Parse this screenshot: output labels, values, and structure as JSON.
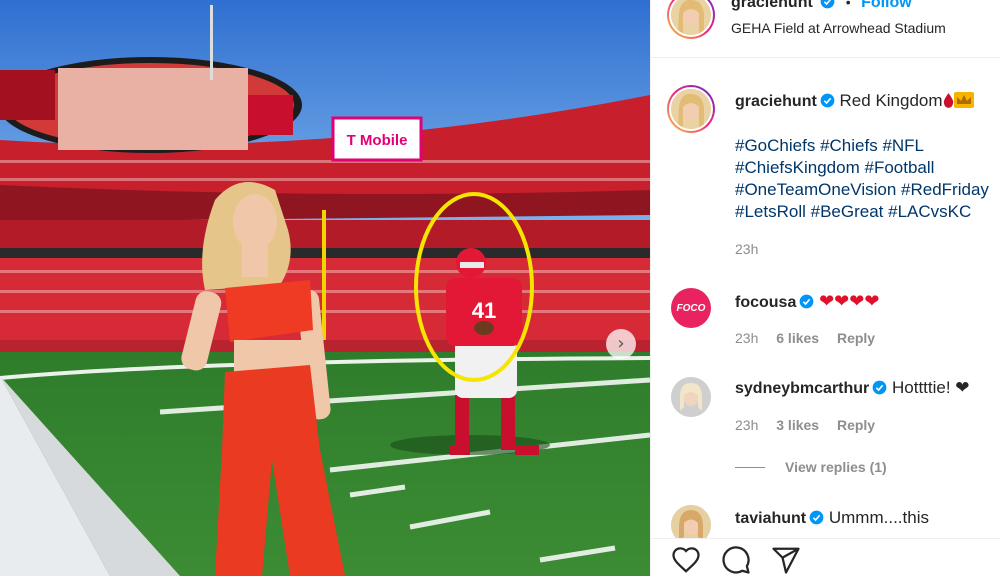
{
  "post": {
    "author": "graciehunt",
    "follow_separator": "•",
    "follow_label": "Follow",
    "location": "GEHA Field at Arrowhead Stadium"
  },
  "photo": {
    "stadium_sign": "T Mobile",
    "player_number": "41",
    "next_icon": "chevron-right-icon"
  },
  "caption": {
    "author": "graciehunt",
    "text": "Red Kingdom",
    "emoji": [
      "drop-of-blood-icon",
      "crown-icon"
    ],
    "hashtags": [
      "#GoChiefs",
      "#Chiefs",
      "#NFL",
      "#ChiefsKingdom",
      "#Football",
      "#OneTeamOneVision",
      "#RedFriday",
      "#LetsRoll",
      "#BeGreat",
      "#LACvsKC"
    ],
    "time": "23h"
  },
  "comments": [
    {
      "author": "focousa",
      "avatar_text": "FOCO",
      "text": "❤❤❤❤",
      "time": "23h",
      "likes": "6 likes",
      "reply": "Reply"
    },
    {
      "author": "sydneybmcarthur",
      "text": "Hottttie! ❤",
      "time": "23h",
      "likes": "3 likes",
      "reply": "Reply",
      "view_replies": "View replies (1)"
    },
    {
      "author": "taviahunt",
      "text": "Ummm....this"
    }
  ],
  "actions": {
    "like_icon": "heart-icon",
    "comment_icon": "comment-icon",
    "share_icon": "send-icon"
  },
  "colors": {
    "link_blue": "#0095f6",
    "hashtag": "#00376b",
    "muted": "#8e8e8e",
    "chiefs_red": "#e31837",
    "highlight_circle": "#f5e500"
  }
}
